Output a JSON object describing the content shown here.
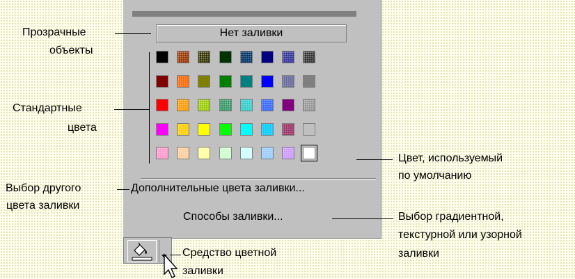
{
  "menu": {
    "no_fill": "Нет заливки",
    "more_colors": "Дополнительные цвета заливки...",
    "fill_effects": "Способы заливки..."
  },
  "labels": {
    "transparent_line1": "Прозрачные",
    "transparent_line2": "объекты",
    "standard_line1": "Стандартные",
    "standard_line2": "цвета",
    "other_line1": "Выбор другого",
    "other_line2": "цвета заливки",
    "default_line1": "Цвет, используемый",
    "default_line2": "по умолчанию",
    "gradient_line1": "Выбор градиентной,",
    "gradient_line2": "текстурной или узорной",
    "gradient_line3": "заливки",
    "tool_line1": "Средство цветной",
    "tool_line2": "заливки"
  },
  "palette": {
    "rows": [
      [
        {
          "c": "#000000"
        },
        {
          "c": "#993300",
          "p": true
        },
        {
          "c": "#333300",
          "p": true
        },
        {
          "c": "#003300"
        },
        {
          "c": "#003366",
          "p": true
        },
        {
          "c": "#000080"
        },
        {
          "c": "#333399",
          "p": true
        },
        {
          "c": "#333333",
          "p": true
        }
      ],
      [
        {
          "c": "#800000"
        },
        {
          "c": "#ff6600",
          "p": true
        },
        {
          "c": "#808000"
        },
        {
          "c": "#008000"
        },
        {
          "c": "#008080"
        },
        {
          "c": "#0000ff"
        },
        {
          "c": "#666699",
          "p": true
        },
        {
          "c": "#808080"
        }
      ],
      [
        {
          "c": "#ff0000"
        },
        {
          "c": "#ff9900",
          "p": true
        },
        {
          "c": "#99cc00",
          "p": true
        },
        {
          "c": "#339966",
          "p": true
        },
        {
          "c": "#33cccc",
          "p": true
        },
        {
          "c": "#3366ff",
          "p": true
        },
        {
          "c": "#800080"
        },
        {
          "c": "#969696",
          "p": true
        }
      ],
      [
        {
          "c": "#ff00ff"
        },
        {
          "c": "#ffcc00",
          "p": true
        },
        {
          "c": "#ffff00"
        },
        {
          "c": "#00ff00"
        },
        {
          "c": "#00ffff"
        },
        {
          "c": "#00ccff",
          "p": true
        },
        {
          "c": "#993366",
          "p": true
        },
        {
          "c": "#c0c0c0"
        }
      ],
      [
        {
          "c": "#ff99cc",
          "p": true
        },
        {
          "c": "#ffcc99",
          "p": true
        },
        {
          "c": "#ffff99",
          "p": true
        },
        {
          "c": "#ccffcc",
          "p": true
        },
        {
          "c": "#ccffff",
          "p": true
        },
        {
          "c": "#99ccff",
          "p": true
        },
        {
          "c": "#cc99ff",
          "p": true
        },
        {
          "c": "#ffffff",
          "sel": true
        }
      ]
    ]
  },
  "colors": {
    "panel": "#c0c0c0",
    "shadow": "#808080"
  }
}
